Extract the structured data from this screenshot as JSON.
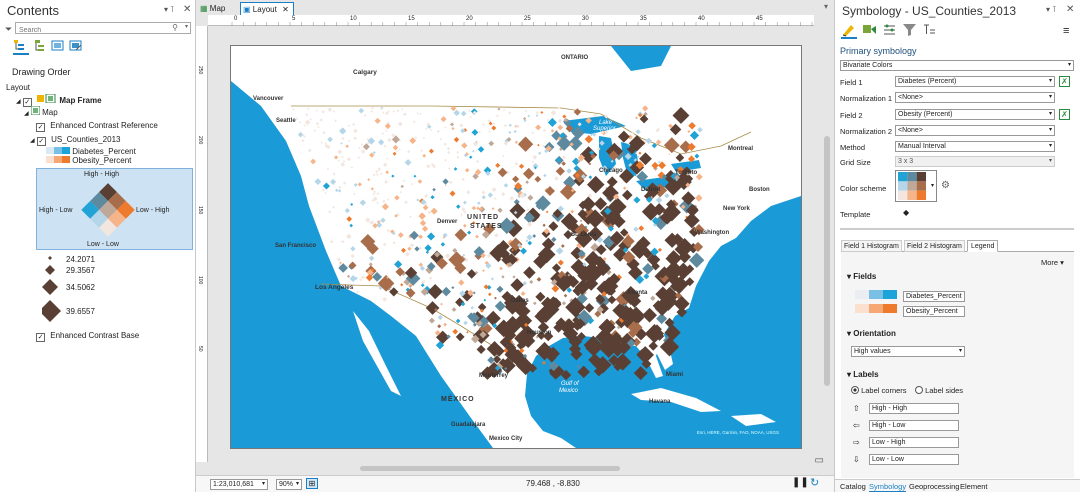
{
  "contents": {
    "title": "Contents",
    "search_placeholder": "Search",
    "drawing_order": "Drawing Order",
    "tree": {
      "layout": "Layout",
      "map_frame": "Map Frame",
      "map": "Map",
      "ecr": "Enhanced Contrast Reference",
      "layer": "US_Counties_2013",
      "field1": "Diabetes_Percent",
      "field2": "Obesity_Percent",
      "high_high": "High - High",
      "high_low_left": "High - Low",
      "low_high_right": "Low - High",
      "low_low": "Low - Low",
      "size_labels": [
        "24.2071",
        "29.3567",
        "34.5062",
        "39.6557"
      ],
      "ecb": "Enhanced Contrast Base"
    }
  },
  "view_tabs": {
    "map": "Map",
    "layout": "Layout"
  },
  "ruler_h_labels": [
    "0",
    "5",
    "10",
    "15",
    "20",
    "25",
    "30",
    "35",
    "40",
    "45"
  ],
  "ruler_v_labels": [
    "250",
    "200",
    "150",
    "100",
    "50"
  ],
  "map_labels": {
    "ontario": "ONTARIO",
    "calgary": "Calgary",
    "vancouver": "Vancouver",
    "seattle": "Seattle",
    "montreal": "Montreal",
    "toronto": "Toronto",
    "boston": "Boston",
    "new_york": "New York",
    "washington": "Washington",
    "chicago": "Chicago",
    "detroit": "Detroit",
    "denver": "Denver",
    "usa1": "UNITED",
    "usa2": "STATES",
    "st_louis": "St. Louis",
    "san_francisco": "San Francisco",
    "los_angeles": "Los Angeles",
    "dallas": "Dallas",
    "atlanta": "Atlanta",
    "houston": "Houston",
    "miami": "Miami",
    "monterrey": "Monterrey",
    "mexico": "MÉXICO",
    "gulf1": "Gulf of",
    "gulf2": "Mexico",
    "lake1": "Lake",
    "lake2": "Superior",
    "havana": "Havana",
    "guadalajara": "Guadalajara",
    "mexico_city": "Mexico City",
    "credit": "Esri, HERE, Garmin, FAO, NOAA, USGS"
  },
  "status": {
    "scale": "1:23,010,681",
    "zoom": "90%",
    "coords": "79.468 , -8.830"
  },
  "symbology": {
    "title": "Symbology - US_Counties_2013",
    "primary": "Primary symbology",
    "method_type": "Bivariate Colors",
    "field1_label": "Field 1",
    "field1_value": "Diabetes (Percent)",
    "norm1_label": "Normalization 1",
    "norm1_value": "<None>",
    "field2_label": "Field 2",
    "field2_value": "Obesity (Percent)",
    "norm2_label": "Normalization 2",
    "norm2_value": "<None>",
    "method_label": "Method",
    "method_value": "Manual Interval",
    "grid_label": "Grid Size",
    "grid_value": "3 x 3",
    "scheme_label": "Color scheme",
    "template_label": "Template",
    "tabs": [
      "Field 1 Histogram",
      "Field 2 Histogram",
      "Legend"
    ],
    "more": "More",
    "fields_header": "Fields",
    "legend_field1": "Diabetes_Percent",
    "legend_field2": "Obesity_Percent",
    "orientation_header": "Orientation",
    "orientation_value": "High values",
    "labels_header": "Labels",
    "radio1": "Label corners",
    "radio2": "Label sides",
    "label_inputs": [
      "High - High",
      "High - Low",
      "Low - High",
      "Low - Low"
    ],
    "bottom_tabs": [
      "Catalog",
      "Symbology",
      "Geoprocessing",
      "Element"
    ]
  },
  "colors": {
    "ocean": "#1a9ad6",
    "land": "#ffffff",
    "dark": "#5a4034",
    "blue": "#2d9ccf",
    "orange": "#f07f2a",
    "lightblue": "#9bd0ee",
    "peach": "#f8c9a6",
    "accent": "#1a7fc4",
    "bivariate": [
      "#f2e6df",
      "#f5b48a",
      "#ee7a2d",
      "#b4d6e8",
      "#bfa898",
      "#a86d4b",
      "#21a3d6",
      "#5e8aa0",
      "#5a4034"
    ]
  }
}
